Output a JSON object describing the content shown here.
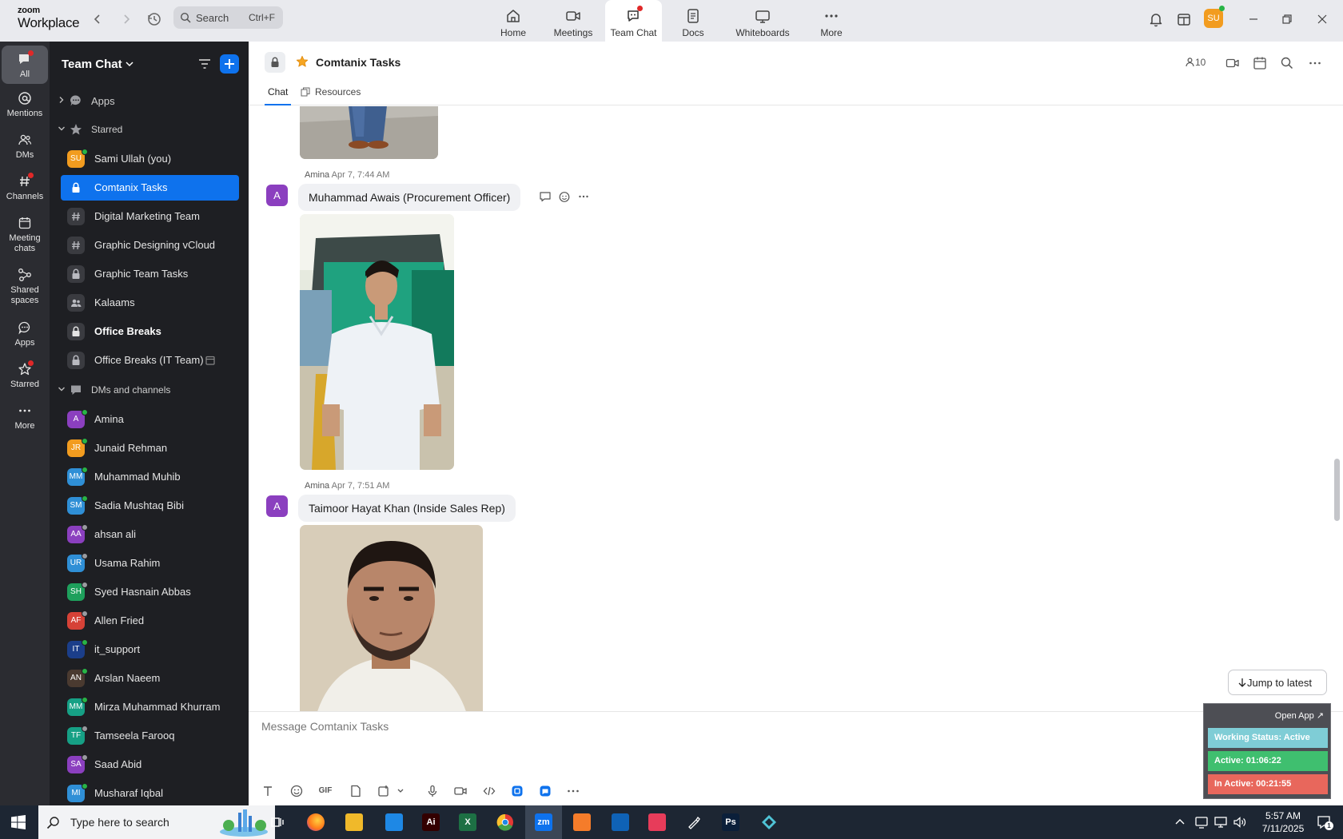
{
  "app": {
    "brand_top": "zoom",
    "brand_bottom": "Workplace"
  },
  "search": {
    "placeholder": "Search",
    "shortcut": "Ctrl+F"
  },
  "main_tabs": [
    {
      "label": "Home",
      "icon": "home-icon"
    },
    {
      "label": "Meetings",
      "icon": "video-camera-icon"
    },
    {
      "label": "Team Chat",
      "icon": "chat-bubble-icon",
      "active": true
    },
    {
      "label": "Docs",
      "icon": "document-icon"
    },
    {
      "label": "Whiteboards",
      "icon": "whiteboard-icon"
    },
    {
      "label": "More",
      "icon": "more-dots-icon"
    }
  ],
  "user": {
    "initials": "SU",
    "avatar_color": "#f29c1f"
  },
  "rail": [
    {
      "label": "All",
      "active": true
    },
    {
      "label": "Mentions"
    },
    {
      "label": "DMs"
    },
    {
      "label": "Channels"
    },
    {
      "label": "Meeting chats"
    },
    {
      "label": "Shared spaces"
    },
    {
      "label": "Apps"
    },
    {
      "label": "Starred"
    },
    {
      "label": "More"
    }
  ],
  "sidebar": {
    "title": "Team Chat",
    "sections": {
      "apps": "Apps",
      "starred": "Starred",
      "dms": "DMs and channels"
    },
    "starred": [
      {
        "name": "Sami Ullah (you)",
        "type": "avatar",
        "initials": "SU",
        "color": "#f29c1f",
        "presence": "#28b446"
      },
      {
        "name": "Comtanix Tasks",
        "type": "lock",
        "selected": true
      },
      {
        "name": "Digital Marketing Team",
        "type": "hash"
      },
      {
        "name": "Graphic Designing vCloud",
        "type": "hash"
      },
      {
        "name": "Graphic Team Tasks",
        "type": "lock"
      },
      {
        "name": "Kalaams",
        "type": "people"
      },
      {
        "name": "Office Breaks",
        "type": "lock",
        "bold": true
      },
      {
        "name": "Office Breaks (IT Team)",
        "type": "lock",
        "extra": "calendar-icon"
      }
    ],
    "dms": [
      {
        "name": "Amina",
        "initials": "A",
        "color": "#8b3fbf",
        "presence": "#28b446"
      },
      {
        "name": "Junaid Rehman",
        "initials": "JR",
        "color": "#f29c1f",
        "presence": "#28b446"
      },
      {
        "name": "Muhammad Muhib",
        "initials": "MM",
        "color": "#2f8fd6",
        "presence": "#28b446"
      },
      {
        "name": "Sadia Mushtaq Bibi",
        "initials": "SM",
        "color": "#2f8fd6",
        "presence": "#28b446"
      },
      {
        "name": "ahsan ali",
        "initials": "AA",
        "color": "#8b3fbf",
        "presence": "#9a9ba0"
      },
      {
        "name": "Usama Rahim",
        "initials": "UR",
        "color": "#2f8fd6",
        "presence": "#9a9ba0"
      },
      {
        "name": "Syed Hasnain Abbas",
        "initials": "SH",
        "color": "#1ea05c",
        "presence": "#9a9ba0"
      },
      {
        "name": "Allen Fried",
        "initials": "AF",
        "color": "#d64237",
        "presence": "#9a9ba0"
      },
      {
        "name": "it_support",
        "initials": "IT",
        "color": "#1b3e8a",
        "presence": "#28b446"
      },
      {
        "name": "Arslan Naeem",
        "initials": "AN",
        "color": "#4a3a30",
        "presence": "#28b446"
      },
      {
        "name": "Mirza Muhammad Khurram",
        "initials": "MM",
        "color": "#16a085",
        "presence": "#28b446"
      },
      {
        "name": "Tamseela Farooq",
        "initials": "TF",
        "color": "#16a085",
        "presence": "#9a9ba0"
      },
      {
        "name": "Saad Abid",
        "initials": "SA",
        "color": "#8b3fbf",
        "presence": "#9a9ba0"
      },
      {
        "name": "Musharaf Iqbal",
        "initials": "MI",
        "color": "#2f8fd6",
        "presence": "#28b446"
      }
    ]
  },
  "chat": {
    "title": "Comtanix Tasks",
    "member_count": "10",
    "tabs": [
      "Chat",
      "Resources"
    ],
    "messages": [
      {
        "sender": "Amina",
        "avatar": "A",
        "time": "Apr 7, 7:44 AM",
        "text": "Muhammad Awais (Procurement Officer)"
      },
      {
        "sender": "Amina",
        "avatar": "A",
        "time": "Apr 7, 7:51 AM",
        "text": "Taimoor Hayat Khan (Inside Sales Rep)"
      }
    ],
    "jump_label": "Jump to latest",
    "composer_placeholder": "Message Comtanix Tasks",
    "composer_gif": "GIF"
  },
  "status_widget": {
    "open_app": "Open App ↗",
    "working_status": "Working Status: Active",
    "active": "Active: 01:06:22",
    "inactive": "In Active: 00:21:55",
    "colors": {
      "status": "#7fcdd6",
      "active": "#3fbf6f",
      "inactive": "#e8675c"
    }
  },
  "taskbar": {
    "search_placeholder": "Type here to search",
    "time": "5:57 AM",
    "date": "7/11/2025",
    "notifications": "1",
    "apps": [
      {
        "name": "task-view",
        "glyph": "",
        "color": "transparent"
      },
      {
        "name": "firefox",
        "glyph": "",
        "color": "#ff7a1a"
      },
      {
        "name": "file-explorer",
        "glyph": "",
        "color": "#f0b92a"
      },
      {
        "name": "vs-code",
        "glyph": "",
        "color": "#1e88e5"
      },
      {
        "name": "illustrator",
        "glyph": "Ai",
        "color": "#330000"
      },
      {
        "name": "excel",
        "glyph": "X",
        "color": "#1d7044"
      },
      {
        "name": "chrome",
        "glyph": "",
        "color": "#e53935"
      },
      {
        "name": "zoom",
        "glyph": "zm",
        "color": "#0e72ed"
      },
      {
        "name": "xampp",
        "glyph": "",
        "color": "#f57c2a"
      },
      {
        "name": "outlook",
        "glyph": "",
        "color": "#0f62b6"
      },
      {
        "name": "creative-cloud",
        "glyph": "",
        "color": "#e73c5a"
      },
      {
        "name": "pen-tool",
        "glyph": "",
        "color": "transparent"
      },
      {
        "name": "photoshop",
        "glyph": "Ps",
        "color": "#0b1f3a"
      },
      {
        "name": "app-diamond",
        "glyph": "",
        "color": "transparent"
      }
    ]
  }
}
